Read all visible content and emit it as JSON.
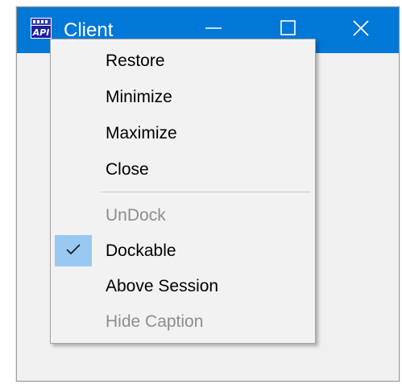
{
  "window": {
    "title": "Client",
    "app_icon_name": "api-app-icon",
    "titlebar_color": "#0078d7",
    "controls": {
      "minimize_icon": "minimize-icon",
      "maximize_icon": "maximize-icon",
      "close_icon": "close-icon"
    }
  },
  "system_menu": {
    "items": [
      {
        "label": "Restore",
        "enabled": true
      },
      {
        "label": "Minimize",
        "enabled": true
      },
      {
        "label": "Maximize",
        "enabled": true
      },
      {
        "label": "Close",
        "enabled": true
      },
      {
        "label": "UnDock",
        "enabled": false
      },
      {
        "label": "Dockable",
        "enabled": true,
        "checked": true
      },
      {
        "label": "Above Session",
        "enabled": true
      },
      {
        "label": "Hide Caption",
        "enabled": false
      }
    ],
    "check_icon": "checkmark-icon",
    "check_highlight_color": "#99c9f2"
  }
}
